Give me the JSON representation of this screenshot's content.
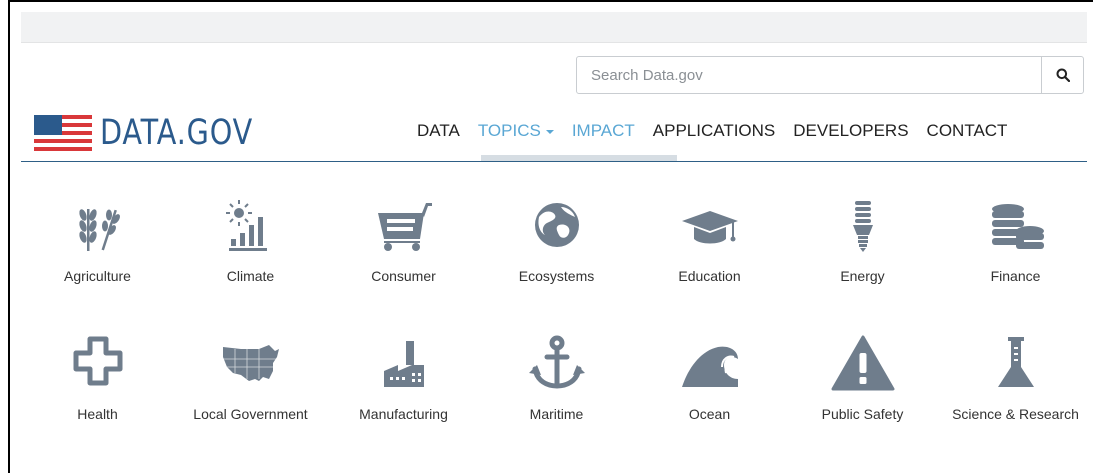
{
  "search": {
    "placeholder": "Search Data.gov"
  },
  "logo": {
    "text": "DATA.GOV"
  },
  "nav": {
    "items": [
      {
        "label": "DATA"
      },
      {
        "label": "TOPICS"
      },
      {
        "label": "IMPACT"
      },
      {
        "label": "APPLICATIONS"
      },
      {
        "label": "DEVELOPERS"
      },
      {
        "label": "CONTACT"
      }
    ]
  },
  "topics": {
    "row1": [
      {
        "label": "Agriculture",
        "icon": "wheat-icon"
      },
      {
        "label": "Climate",
        "icon": "sun-chart-icon"
      },
      {
        "label": "Consumer",
        "icon": "shopping-cart-icon"
      },
      {
        "label": "Ecosystems",
        "icon": "globe-icon"
      },
      {
        "label": "Education",
        "icon": "graduation-cap-icon"
      },
      {
        "label": "Energy",
        "icon": "lightbulb-icon"
      },
      {
        "label": "Finance",
        "icon": "coins-icon"
      }
    ],
    "row2": [
      {
        "label": "Health",
        "icon": "medical-cross-icon"
      },
      {
        "label": "Local Government",
        "icon": "us-map-icon"
      },
      {
        "label": "Manufacturing",
        "icon": "factory-icon"
      },
      {
        "label": "Maritime",
        "icon": "anchor-icon"
      },
      {
        "label": "Ocean",
        "icon": "wave-icon"
      },
      {
        "label": "Public Safety",
        "icon": "warning-icon"
      },
      {
        "label": "Science & Research",
        "icon": "flask-icon"
      }
    ]
  },
  "colors": {
    "icon": "#6f7d8c",
    "brand": "#2b5a8c",
    "active_nav": "#5aa7d4",
    "flag_red": "#d9383a"
  }
}
